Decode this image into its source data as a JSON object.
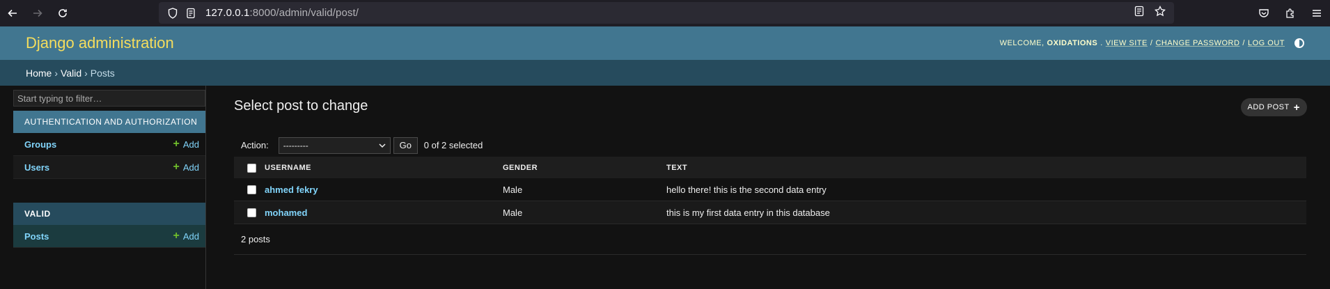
{
  "browser": {
    "url_host": "127.0.0.1",
    "url_path": ":8000/admin/valid/post/"
  },
  "header": {
    "brand": "Django administration",
    "welcome": "WELCOME,",
    "username": "OXIDATIONS",
    "view_site": "VIEW SITE",
    "change_password": "CHANGE PASSWORD",
    "log_out": "LOG OUT",
    "sep": "/"
  },
  "breadcrumbs": {
    "home": "Home",
    "app": "Valid",
    "current": "Posts",
    "sep": "›"
  },
  "sidebar": {
    "filter_placeholder": "Start typing to filter…",
    "apps": [
      {
        "caption": "AUTHENTICATION AND AUTHORIZATION",
        "models": [
          {
            "name": "Groups",
            "add": "Add"
          },
          {
            "name": "Users",
            "add": "Add"
          }
        ]
      },
      {
        "caption": "VALID",
        "models": [
          {
            "name": "Posts",
            "add": "Add"
          }
        ]
      }
    ]
  },
  "content": {
    "title": "Select post to change",
    "add_button": "ADD POST",
    "action_label": "Action:",
    "action_value": "---------",
    "go_label": "Go",
    "selected_count": "0 of 2 selected",
    "columns": [
      "USERNAME",
      "GENDER",
      "TEXT"
    ],
    "rows": [
      {
        "username": "ahmed fekry",
        "gender": "Male",
        "text": "hello there! this is the second data entry"
      },
      {
        "username": "mohamed",
        "gender": "Male",
        "text": "this is my first data entry in this database"
      }
    ],
    "paginator": "2 posts"
  },
  "colors": {
    "header_bg": "#417690",
    "brand": "#f5dd5d",
    "breadcrumb_bg": "#264b5d",
    "link": "#81d4fa",
    "add_plus": "#70bf2b"
  }
}
